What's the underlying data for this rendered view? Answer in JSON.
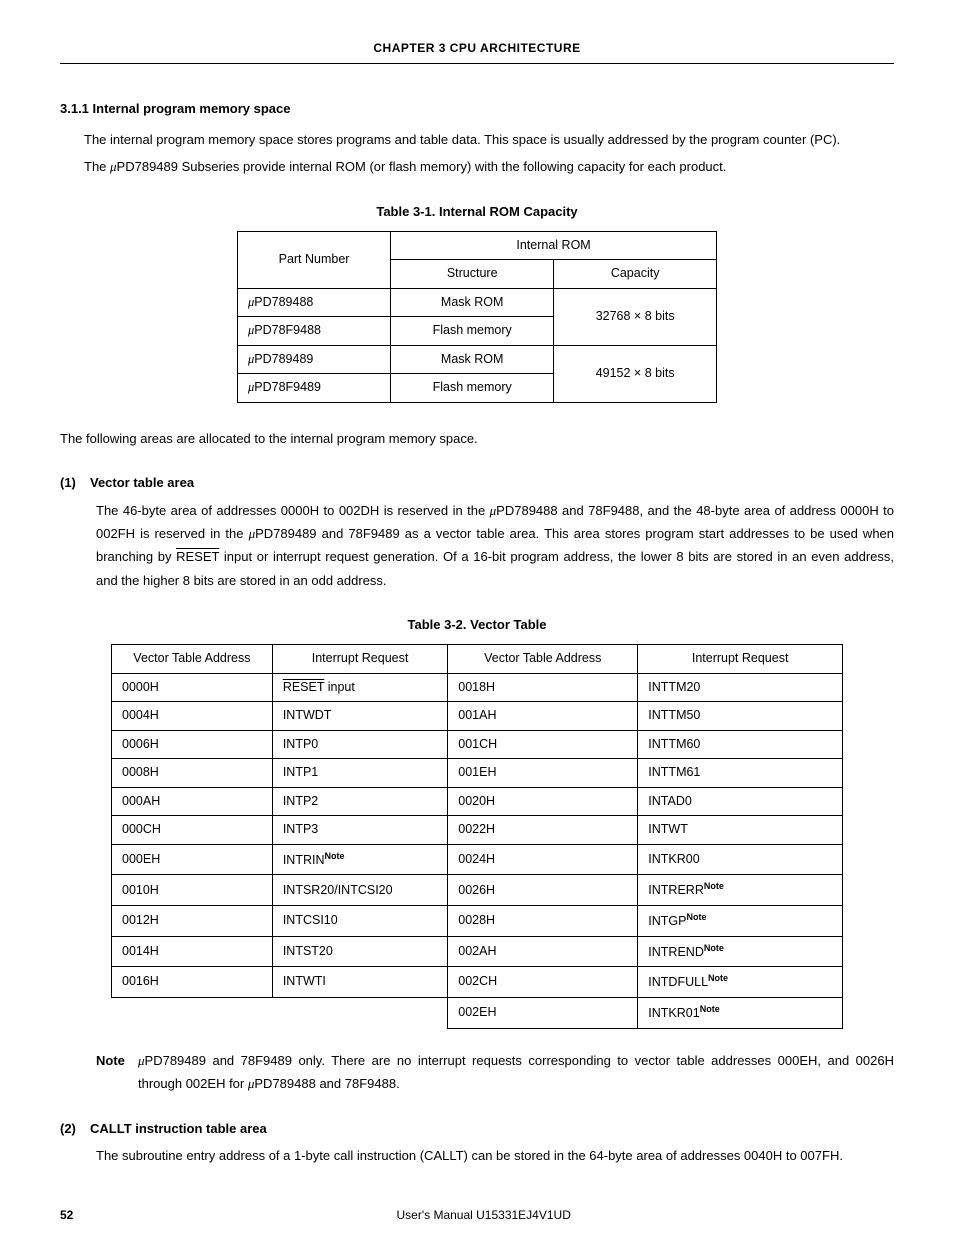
{
  "chapterHeader": "CHAPTER 3  CPU ARCHITECTURE",
  "section": {
    "heading": "3.1.1  Internal program memory space",
    "para1a": "The internal program memory space stores programs and table data.  This space is usually addressed by the program counter (PC).",
    "para1b_pre": "The ",
    "para1b_mid": "PD789489 Subseries provide internal ROM (or flash memory) with the following capacity for each product."
  },
  "table1": {
    "title": "Table 3-1.  Internal ROM Capacity",
    "h_part": "Part Number",
    "h_rom": "Internal ROM",
    "h_struct": "Structure",
    "h_cap": "Capacity",
    "rows": [
      {
        "part": "PD789488",
        "struct": "Mask ROM",
        "cap": "32768 × 8 bits"
      },
      {
        "part": "PD78F9488",
        "struct": "Flash memory",
        "cap": ""
      },
      {
        "part": "PD789489",
        "struct": "Mask ROM",
        "cap": "49152 × 8 bits"
      },
      {
        "part": "PD78F9489",
        "struct": "Flash memory",
        "cap": ""
      }
    ]
  },
  "followupPara": "The following areas are allocated to the internal program memory space.",
  "vectorSection": {
    "num": "(1)",
    "title": "Vector table area",
    "body_a": "The 46-byte area of addresses 0000H to 002DH is reserved in the ",
    "body_b": "PD789488 and 78F9488, and the 48-byte area of address 0000H to 002FH is reserved in the ",
    "body_c": "PD789489 and 78F9489 as a vector table area.  This area stores program start addresses to be used when branching by ",
    "reset": "RESET",
    "body_d": " input or interrupt request generation.  Of a 16-bit program address, the lower 8 bits are stored in an even address, and the higher 8 bits are stored in an odd address."
  },
  "table2": {
    "title": "Table 3-2.  Vector Table",
    "h_addr": "Vector Table Address",
    "h_irq": "Interrupt Request",
    "rows": [
      {
        "a1": "0000H",
        "r1": "RESET",
        "r1_suffix": " input",
        "r1_over": true,
        "a2": "0018H",
        "r2": "INTTM20"
      },
      {
        "a1": "0004H",
        "r1": "INTWDT",
        "a2": "001AH",
        "r2": "INTTM50"
      },
      {
        "a1": "0006H",
        "r1": "INTP0",
        "a2": "001CH",
        "r2": "INTTM60"
      },
      {
        "a1": "0008H",
        "r1": "INTP1",
        "a2": "001EH",
        "r2": "INTTM61"
      },
      {
        "a1": "000AH",
        "r1": "INTP2",
        "a2": "0020H",
        "r2": "INTAD0"
      },
      {
        "a1": "000CH",
        "r1": "INTP3",
        "a2": "0022H",
        "r2": "INTWT"
      },
      {
        "a1": "000EH",
        "r1": "INTRIN",
        "r1_note": true,
        "a2": "0024H",
        "r2": "INTKR00"
      },
      {
        "a1": "0010H",
        "r1": "INTSR20/INTCSI20",
        "a2": "0026H",
        "r2": "INTRERR",
        "r2_note": true
      },
      {
        "a1": "0012H",
        "r1": "INTCSI10",
        "a2": "0028H",
        "r2": "INTGP",
        "r2_note": true
      },
      {
        "a1": "0014H",
        "r1": "INTST20",
        "a2": "002AH",
        "r2": "INTREND",
        "r2_note": true
      },
      {
        "a1": "0016H",
        "r1": "INTWTI",
        "a2": "002CH",
        "r2": "INTDFULL",
        "r2_note": true
      },
      {
        "a1": "",
        "r1": "",
        "empty_left": true,
        "a2": "002EH",
        "r2": "INTKR01",
        "r2_note": true
      }
    ]
  },
  "note": {
    "label": "Note",
    "body_a": "PD789489 and 78F9489 only.  There are no interrupt requests corresponding to vector table addresses 000EH, and 0026H through 002EH for ",
    "body_b": "PD789488 and 78F9488."
  },
  "calltSection": {
    "num": "(2)",
    "title": "CALLT instruction table area",
    "body": "The subroutine entry address of a 1-byte call instruction (CALLT) can be stored in the 64-byte area of addresses 0040H to 007FH."
  },
  "footer": {
    "page": "52",
    "manual": "User's Manual  U15331EJ4V1UD"
  },
  "noteSup": "Note"
}
